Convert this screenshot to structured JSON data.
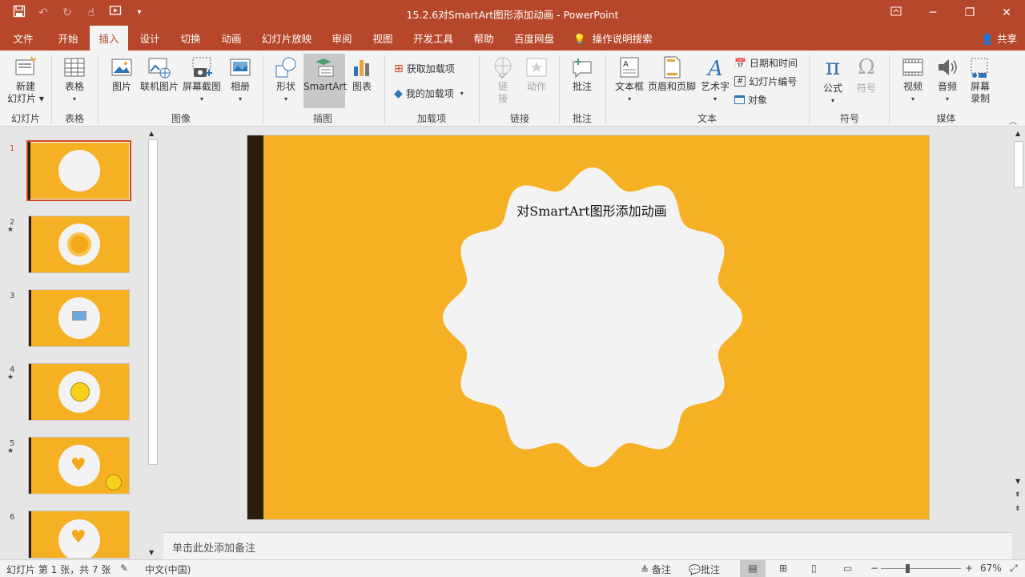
{
  "title_bar": {
    "document_title": "15.2.6对SmartArt图形添加动画",
    "app_name": "PowerPoint",
    "qat_icons": [
      "save-icon",
      "undo-icon",
      "redo-icon",
      "touch-mode-icon",
      "start-from-beginning-icon",
      "customize-qat-icon"
    ],
    "window_controls": [
      "ribbon-display-options-icon",
      "minimize-icon",
      "restore-icon",
      "close-icon"
    ]
  },
  "menu": {
    "tabs": [
      "文件",
      "开始",
      "插入",
      "设计",
      "切换",
      "动画",
      "幻灯片放映",
      "审阅",
      "视图",
      "开发工具",
      "帮助",
      "百度网盘"
    ],
    "active_tab": "插入",
    "tell_me": "操作说明搜索",
    "share": "共享"
  },
  "ribbon": {
    "new_slide": {
      "line1": "新建",
      "line2": "幻灯片"
    },
    "table": "表格",
    "picture": "图片",
    "online_picture": "联机图片",
    "screenshot": "屏幕截图",
    "album": "相册",
    "shapes": "形状",
    "smartart": "SmartArt",
    "chart": "图表",
    "get_addins": "获取加载项",
    "my_addins": "我的加载项",
    "link": {
      "line1": "链",
      "line2": "接"
    },
    "action": "动作",
    "comment": "批注",
    "textbox": "文本框",
    "header_footer": "页眉和页脚",
    "wordart": "艺术字",
    "date_time": "日期和时间",
    "slide_number": "幻灯片编号",
    "object": "对象",
    "equation": "公式",
    "symbol": "符号",
    "video": "视频",
    "audio": "音频",
    "screen_record": {
      "line1": "屏幕",
      "line2": "录制"
    },
    "groups": {
      "slides": "幻灯片",
      "tables": "表格",
      "images": "图像",
      "illustrations": "插图",
      "addins": "加载项",
      "links": "链接",
      "comments": "批注",
      "text": "文本",
      "symbols": "符号",
      "media": "媒体"
    }
  },
  "thumbnails": {
    "numbers": [
      "1",
      "2",
      "3",
      "4",
      "5",
      "6"
    ],
    "animation_marker": "★",
    "active_index": 1
  },
  "slide": {
    "title": "对SmartArt图形添加动画",
    "background_color": "#f6b024",
    "bar_color": "#2b1d0a",
    "shape_color": "#f3f3f3"
  },
  "notes": {
    "placeholder": "单击此处添加备注"
  },
  "status": {
    "slide_info": "幻灯片 第 1 张，共 7 张",
    "language": "中文(中国)",
    "notes_button": "备注",
    "comments_button": "批注",
    "zoom": "67%"
  },
  "colors": {
    "accent": "#b7472a"
  }
}
